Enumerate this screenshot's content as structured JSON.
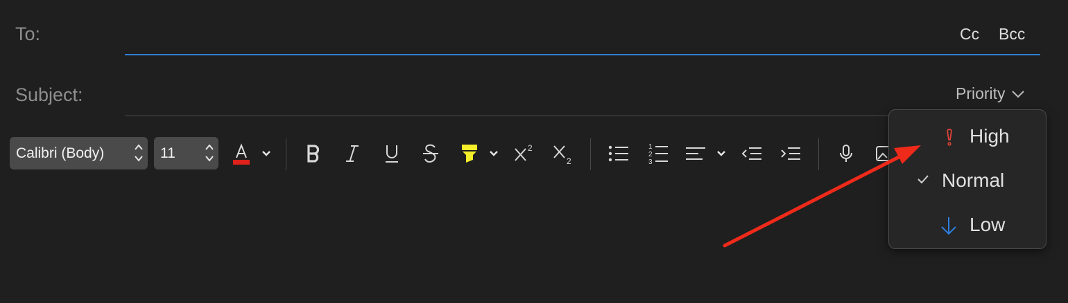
{
  "header": {
    "to_label": "To:",
    "subject_label": "Subject:",
    "cc_label": "Cc",
    "bcc_label": "Bcc",
    "priority_label": "Priority"
  },
  "toolbar": {
    "font_family": "Calibri (Body)",
    "font_size": "11",
    "font_color": "#e0201a",
    "highlight_color": "#f5ef2a",
    "numbered_list_digits": [
      "1",
      "2",
      "3"
    ],
    "superscript_digit": "2",
    "subscript_digit": "2"
  },
  "priority_menu": {
    "items": [
      {
        "label": "High",
        "icon": "exclamation-icon",
        "color": "#e0433a"
      },
      {
        "label": "Normal",
        "icon": "checkmark-icon",
        "checked": true
      },
      {
        "label": "Low",
        "icon": "arrow-down-icon",
        "color": "#2d7fe0"
      }
    ]
  },
  "annotation": {
    "color": "#ee2a1a",
    "icon": "red-arrow"
  }
}
